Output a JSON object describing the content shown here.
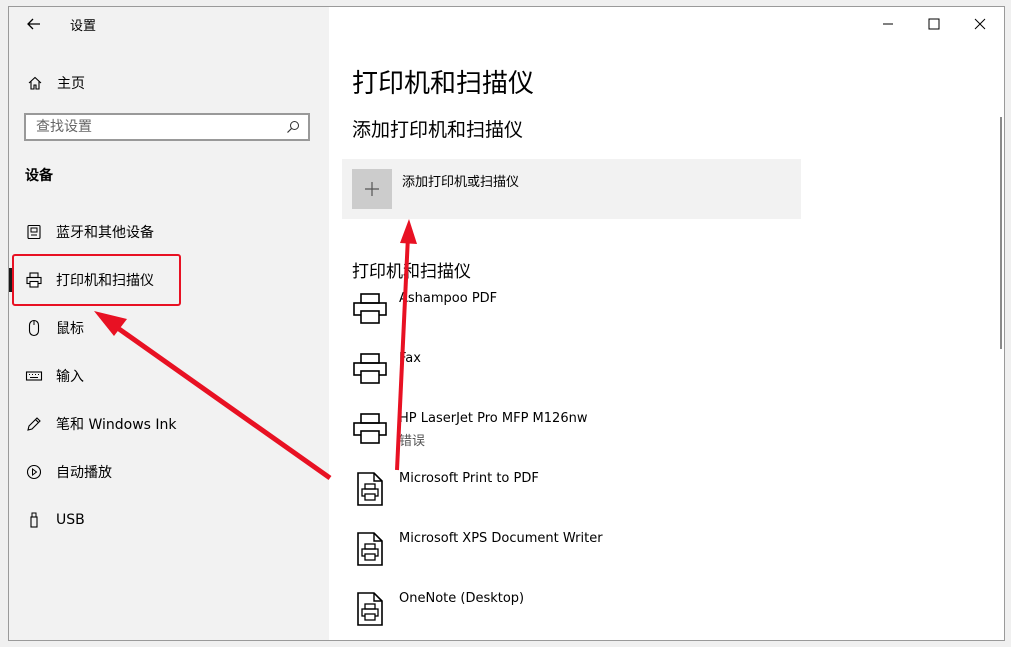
{
  "window": {
    "title": "设置",
    "controls": {
      "minimize": "minimize",
      "maximize": "maximize",
      "close": "close"
    }
  },
  "sidebar": {
    "home_label": "主页",
    "search_placeholder": "查找设置",
    "section_title": "设备",
    "items": [
      {
        "label": "蓝牙和其他设备",
        "icon": "bluetooth-devices-icon"
      },
      {
        "label": "打印机和扫描仪",
        "icon": "printer-icon",
        "active": true
      },
      {
        "label": "鼠标",
        "icon": "mouse-icon"
      },
      {
        "label": "输入",
        "icon": "keyboard-icon"
      },
      {
        "label": "笔和 Windows Ink",
        "icon": "pen-icon"
      },
      {
        "label": "自动播放",
        "icon": "autoplay-icon"
      },
      {
        "label": "USB",
        "icon": "usb-icon"
      }
    ]
  },
  "main": {
    "title": "打印机和扫描仪",
    "add_section_title": "添加打印机和扫描仪",
    "add_button_label": "添加打印机或扫描仪",
    "list_title": "打印机和扫描仪",
    "printers": [
      {
        "name": "Ashampoo PDF",
        "status": "",
        "icon": "printer-icon"
      },
      {
        "name": "Fax",
        "status": "",
        "icon": "printer-icon"
      },
      {
        "name": "HP LaserJet Pro MFP M126nw",
        "status": "错误",
        "icon": "printer-icon"
      },
      {
        "name": "Microsoft Print to PDF",
        "status": "",
        "icon": "document-printer-icon"
      },
      {
        "name": "Microsoft XPS Document Writer",
        "status": "",
        "icon": "document-printer-icon"
      },
      {
        "name": "OneNote (Desktop)",
        "status": "",
        "icon": "document-printer-icon"
      }
    ]
  },
  "annotation": {
    "color": "#e81123"
  }
}
